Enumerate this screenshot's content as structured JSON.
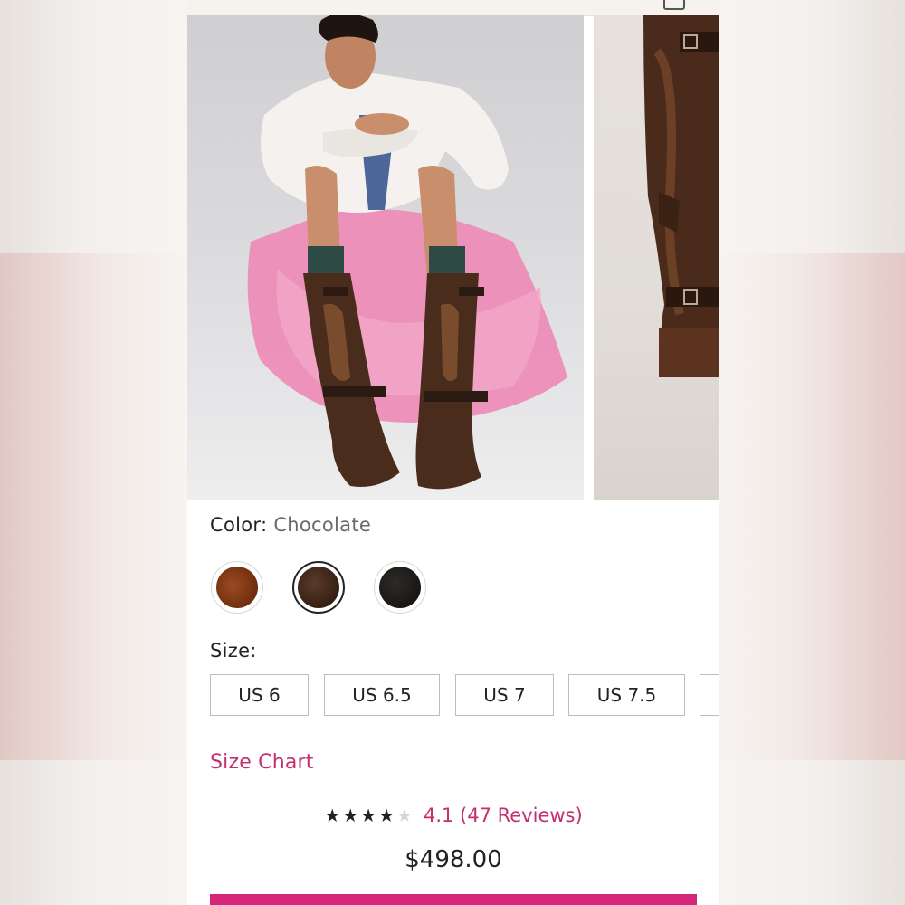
{
  "product": {
    "color_label": "Color:",
    "color_value": "Chocolate",
    "swatches": [
      {
        "name": "Cognac",
        "color": "#7a3412",
        "selected": false
      },
      {
        "name": "Chocolate",
        "color": "#3b2418",
        "selected": true
      },
      {
        "name": "Black",
        "color": "#1c1a18",
        "selected": false
      }
    ],
    "size_label": "Size:",
    "sizes": [
      "US 6",
      "US 6.5",
      "US 7",
      "US 7.5"
    ],
    "size_chart_link": "Size Chart",
    "rating": {
      "stars": "★★★★",
      "stars_off": "★",
      "value": 4.1,
      "text": "4.1 (47 Reviews)"
    },
    "price": "$498.00"
  },
  "colors": {
    "accent": "#c2306f",
    "cta": "#d6267a",
    "text": "#222222"
  },
  "images": {
    "main": "model-sitting-in-pink-tulle-skirt-wearing-brown-boots",
    "secondary": "close-up-brown-leather-boot"
  }
}
